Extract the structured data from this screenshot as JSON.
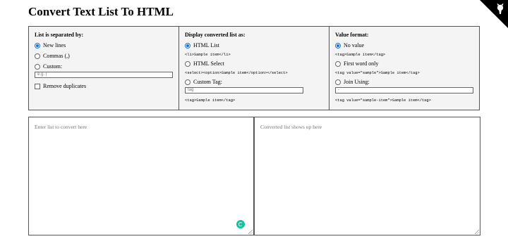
{
  "page": {
    "title": "Convert Text List To HTML"
  },
  "separator": {
    "heading": "List is separated by:",
    "options": [
      {
        "label": "New lines",
        "selected": true
      },
      {
        "label": "Commas (,)",
        "selected": false
      },
      {
        "label": "Custom:",
        "selected": false
      }
    ],
    "custom_placeholder": "e.g. |",
    "remove_duplicates_label": "Remove duplicates",
    "remove_duplicates_checked": false
  },
  "display": {
    "heading": "Display converted list as:",
    "options": [
      {
        "label": "HTML List",
        "example": "<li>Sample item</li>",
        "selected": true
      },
      {
        "label": "HTML Select",
        "example": "<select><option>Sample item</option></select>",
        "selected": false
      },
      {
        "label": "Custom Tag:",
        "example": "<tag>Sample item</tag>",
        "selected": false
      }
    ],
    "custom_tag_placeholder": "tag"
  },
  "value_format": {
    "heading": "Value format:",
    "options": [
      {
        "label": "No value",
        "example": "<tag>Sample item</tag>",
        "selected": true
      },
      {
        "label": "First word only",
        "example": "<tag value=\"sample\">Sample item</tag>",
        "selected": false
      },
      {
        "label": "Join Using:",
        "example": "<tag value=\"sample-item\">Sample item</tag>",
        "selected": false
      }
    ],
    "join_value": "-"
  },
  "input_area": {
    "placeholder": "Enter list to convert here"
  },
  "output_area": {
    "placeholder": "Converted list shows up here"
  },
  "colors": {
    "radio_selected": "#1a6fe0",
    "grammarly": "#15c39a"
  },
  "icons": {
    "corner": "github-octocat-icon",
    "grammarly": "grammarly-icon"
  }
}
